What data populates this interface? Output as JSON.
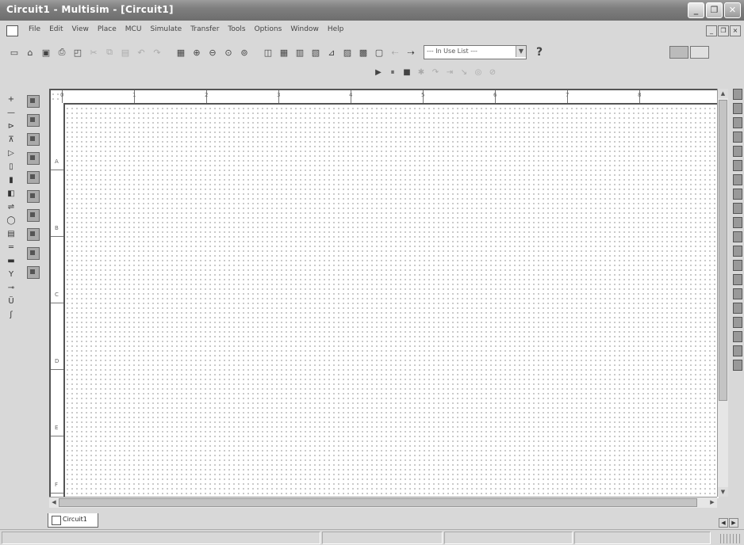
{
  "window": {
    "title": "Circuit1 - Multisim - [Circuit1]"
  },
  "menu": [
    "File",
    "Edit",
    "View",
    "Place",
    "MCU",
    "Simulate",
    "Transfer",
    "Tools",
    "Options",
    "Window",
    "Help"
  ],
  "toolbar": {
    "icons": [
      "new-icon",
      "open-icon",
      "save-icon",
      "print-icon",
      "print-preview-icon",
      "cut-icon",
      "copy-icon",
      "paste-icon",
      "undo-icon",
      "redo-icon",
      "fullscreen-icon",
      "zoom-in-icon",
      "zoom-out-icon",
      "zoom-area-icon",
      "zoom-fit-icon",
      "design-toolbox-icon",
      "spreadsheet-icon",
      "database-icon",
      "component-wizard-icon",
      "grapher-icon",
      "postprocessor-icon",
      "electrical-rules-icon",
      "capture-screen-icon",
      "back-annotate-icon",
      "forward-annotate-icon"
    ],
    "in_use_list": "--- In Use List ---",
    "help_label": "?"
  },
  "tab": {
    "label": "Circuit1"
  },
  "ruler": {
    "top_labels": [
      "0",
      "1",
      "2",
      "3",
      "4",
      "5",
      "6",
      "7",
      "8"
    ],
    "left_labels": [
      "A",
      "B",
      "C",
      "D",
      "E",
      "F"
    ]
  }
}
